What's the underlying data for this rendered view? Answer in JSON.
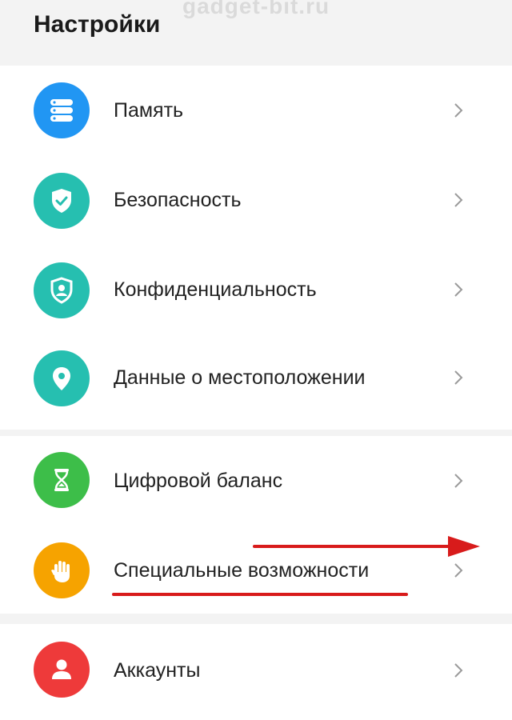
{
  "header": {
    "title": "Настройки"
  },
  "items": [
    {
      "label": "Память",
      "icon": "storage-icon",
      "color": "#2196F3"
    },
    {
      "label": "Безопасность",
      "icon": "security-shield-icon",
      "color": "#26BFB0"
    },
    {
      "label": "Конфиденциальность",
      "icon": "privacy-icon",
      "color": "#26BFB0"
    },
    {
      "label": "Данные о местоположении",
      "icon": "location-icon",
      "color": "#26BFB0"
    },
    {
      "label": "Цифровой баланс",
      "icon": "hourglass-icon",
      "color": "#3DBE49"
    },
    {
      "label": "Специальные возможности",
      "icon": "hand-icon",
      "color": "#F6A300"
    },
    {
      "label": "Аккаунты",
      "icon": "account-icon",
      "color": "#EE3A3A"
    }
  ],
  "watermark": {
    "text": "gadget-bit.ru"
  },
  "annotation": {
    "color": "#D81B1B"
  }
}
